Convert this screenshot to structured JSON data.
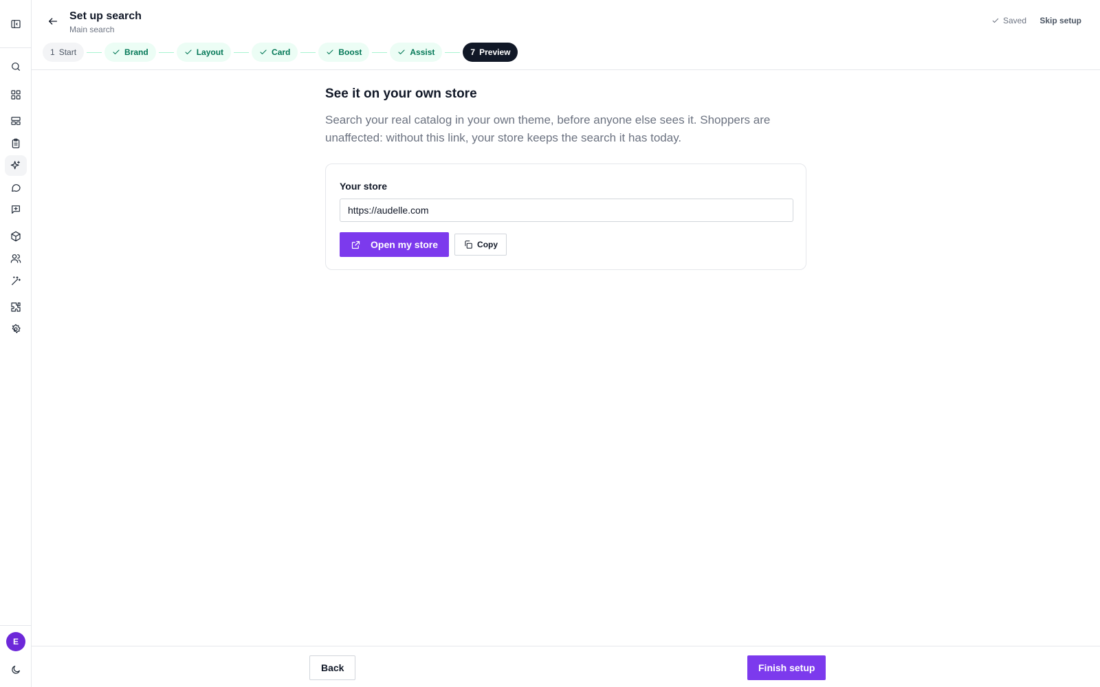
{
  "header": {
    "title": "Set up search",
    "subtitle": "Main search",
    "saved_label": "Saved",
    "skip_label": "Skip setup"
  },
  "steps": [
    {
      "label": "Start",
      "num": "1",
      "state": "plain"
    },
    {
      "label": "Brand",
      "state": "done"
    },
    {
      "label": "Layout",
      "state": "done"
    },
    {
      "label": "Card",
      "state": "done"
    },
    {
      "label": "Boost",
      "state": "done"
    },
    {
      "label": "Assist",
      "state": "done"
    },
    {
      "label": "Preview",
      "num": "7",
      "state": "current"
    }
  ],
  "main": {
    "heading": "See it on your own store",
    "description": "Search your real catalog in your own theme, before anyone else sees it. Shoppers are unaffected: without this link, your store keeps the search it has today.",
    "card": {
      "label": "Your store",
      "url_value": "https://audelle.com",
      "open_label": "Open my store",
      "copy_label": "Copy"
    }
  },
  "footer": {
    "back_label": "Back",
    "finish_label": "Finish setup"
  },
  "user": {
    "avatar_initial": "E"
  },
  "rail_icons": [
    "panel-toggle-icon",
    "search-icon",
    "dashboard-icon",
    "layout-icon",
    "clipboard-icon",
    "sparkles-icon",
    "chat-icon",
    "message-plus-icon",
    "box-icon",
    "users-icon",
    "magic-wand-icon",
    "puzzle-icon",
    "settings-icon",
    "moon-icon"
  ],
  "colors": {
    "accent": "#7c3aed",
    "done_bg": "#ecfdf5",
    "done_text": "#047857",
    "current_bg": "#111827"
  }
}
